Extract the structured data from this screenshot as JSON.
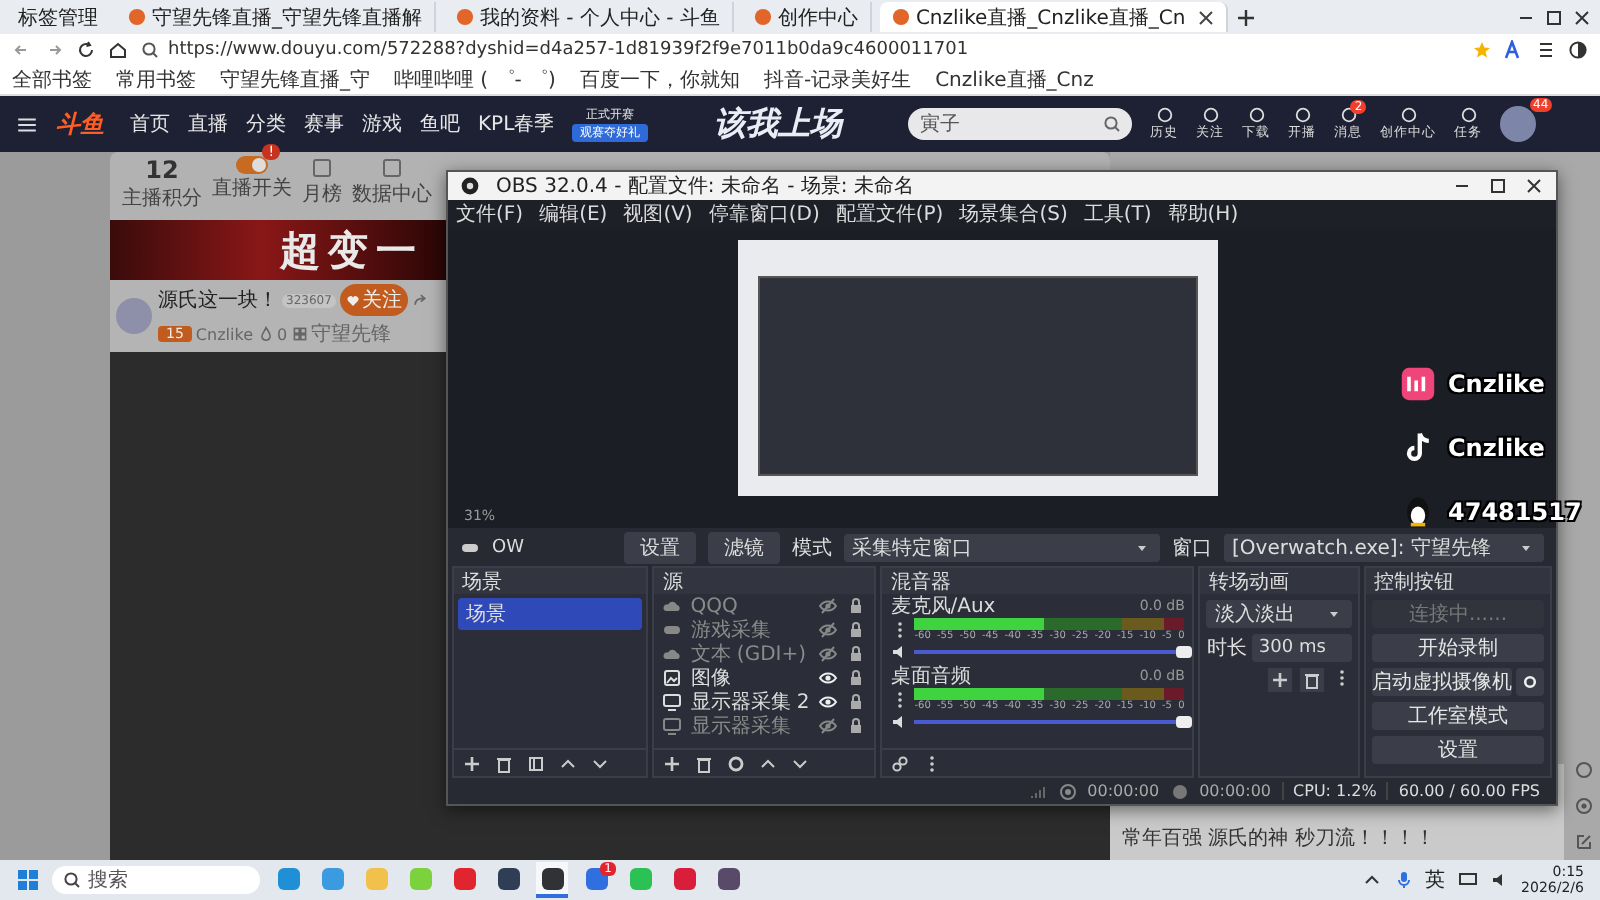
{
  "browser": {
    "tabs_menu": "标签管理",
    "tabs": [
      {
        "title": "守望先锋直播_守望先锋直播解",
        "selected": false
      },
      {
        "title": "我的资料 - 个人中心 - 斗鱼",
        "selected": false
      },
      {
        "title": "创作中心",
        "selected": false
      },
      {
        "title": "Cnzlike直播_Cnzlike直播_Cn",
        "selected": true
      }
    ],
    "url": "https://www.douyu.com/572288?dyshid=d4a257-1d81939f2f9e7011b0da9c4600011701",
    "bookmarks": [
      "全部书签",
      "常用书签",
      "守望先锋直播_守",
      "哔哩哔哩 ( ゜- ゜)",
      "百度一下，你就知",
      "抖音-记录美好生",
      "Cnzlike直播_Cnz"
    ]
  },
  "douyu": {
    "logo": "斗鱼",
    "nav": [
      "首页",
      "直播",
      "分类",
      "赛事",
      "游戏",
      "鱼吧",
      "KPL春季"
    ],
    "event": {
      "title": "正式开赛",
      "button": "观赛夺好礼"
    },
    "banner_text": "该我上场",
    "search": {
      "placeholder": "寅子"
    },
    "actions": [
      {
        "label": "历史"
      },
      {
        "label": "关注"
      },
      {
        "label": "下载"
      },
      {
        "label": "开播"
      },
      {
        "label": "消息",
        "badge": "2"
      },
      {
        "label": "创作中心"
      },
      {
        "label": "任务"
      }
    ],
    "avatar_badge": "44",
    "subnav": [
      {
        "kind": "stat",
        "value": "12",
        "label": "主播积分"
      },
      {
        "kind": "toggle",
        "label": "直播开关",
        "on": true,
        "badge": "!"
      },
      {
        "kind": "icon",
        "label": "月榜"
      },
      {
        "kind": "icon",
        "label": "数据中心"
      }
    ],
    "ad_text": "超变一",
    "streamer": {
      "name": "源氏这一块！",
      "room": "323607",
      "follow": "关注",
      "level": "15",
      "nickname": "Cnzlike",
      "heat": "0",
      "category": "守望先锋"
    },
    "overlay": [
      {
        "kind": "pink",
        "text": "Cnzlike"
      },
      {
        "kind": "tiktok",
        "text": "Cnzlike"
      },
      {
        "kind": "qq",
        "text": "47481517"
      }
    ],
    "chat": "常年百强 源氏的神 秒刀流！！！！"
  },
  "obs": {
    "title": "OBS 32.0.4 - 配置文件: 未命名 - 场景: 未命名",
    "menu": [
      "文件(F)",
      "编辑(E)",
      "视图(V)",
      "停靠窗口(D)",
      "配置文件(P)",
      "场景集合(S)",
      "工具(T)",
      "帮助(H)"
    ],
    "zoom": "31%",
    "source_bar": {
      "name": "OW",
      "buttons": [
        "设置",
        "滤镜"
      ],
      "mode_label": "模式",
      "mode": "采集特定窗口",
      "window_label": "窗口",
      "window": "[Overwatch.exe]: 守望先锋"
    },
    "scenes": {
      "title": "场景",
      "items": [
        {
          "name": "场景",
          "selected": true
        }
      ]
    },
    "sources": {
      "title": "源",
      "items": [
        {
          "name": "QQQ",
          "kind": "text",
          "visible": false
        },
        {
          "name": "游戏采集",
          "kind": "game",
          "visible": false
        },
        {
          "name": "文本 (GDI+)",
          "kind": "text",
          "visible": false
        },
        {
          "name": "图像",
          "kind": "image",
          "visible": true
        },
        {
          "name": "显示器采集 2",
          "kind": "display",
          "visible": true
        },
        {
          "name": "显示器采集",
          "kind": "display",
          "visible": false
        }
      ]
    },
    "mixer": {
      "title": "混音器",
      "channels": [
        {
          "name": "麦克风/Aux",
          "reading": "0.0 dB",
          "level": 1,
          "ticks": [
            "-60",
            "-55",
            "-50",
            "-45",
            "-40",
            "-35",
            "-30",
            "-25",
            "-20",
            "-15",
            "-10",
            "-5",
            "0"
          ]
        },
        {
          "name": "桌面音频",
          "reading": "0.0 dB",
          "level": 1,
          "ticks": [
            "-60",
            "-55",
            "-50",
            "-45",
            "-40",
            "-35",
            "-30",
            "-25",
            "-20",
            "-15",
            "-10",
            "-5",
            "0"
          ]
        }
      ]
    },
    "transitions": {
      "title": "转场动画",
      "type": "淡入淡出",
      "duration_label": "时长",
      "duration": "300 ms"
    },
    "controls": {
      "title": "控制按钮",
      "buttons": [
        {
          "label": "连接中......",
          "disabled": true,
          "settings": false
        },
        {
          "label": "开始录制",
          "disabled": false,
          "settings": false
        },
        {
          "label": "启动虚拟摄像机",
          "disabled": false,
          "settings": true
        },
        {
          "label": "工作室模式",
          "disabled": false,
          "settings": false
        },
        {
          "label": "设置",
          "disabled": false,
          "settings": false
        }
      ]
    },
    "status": {
      "stream_time": "00:00:00",
      "record_time": "00:00:00",
      "cpu": "CPU: 1.2%",
      "fps": "60.00 / 60.00 FPS"
    }
  },
  "taskbar": {
    "search": {
      "placeholder": "搜索"
    },
    "apps": [
      {
        "color": "#1f8fd6",
        "selected": false
      },
      {
        "color": "#3a9be0",
        "selected": false
      },
      {
        "color": "#f2c14b",
        "selected": false
      },
      {
        "color": "#7bd23c",
        "selected": false
      },
      {
        "color": "#e0252f",
        "selected": false
      },
      {
        "color": "#2f3e55",
        "selected": false
      },
      {
        "color": "#303236",
        "selected": true
      },
      {
        "color": "#2f6fe0",
        "selected": false,
        "badge": "1"
      },
      {
        "color": "#2bc155",
        "selected": false
      },
      {
        "color": "#d81e3a",
        "selected": false
      },
      {
        "color": "#5a4a6a",
        "selected": false
      }
    ],
    "ime": "英",
    "time": "0:15",
    "date": "2026/2/6"
  }
}
